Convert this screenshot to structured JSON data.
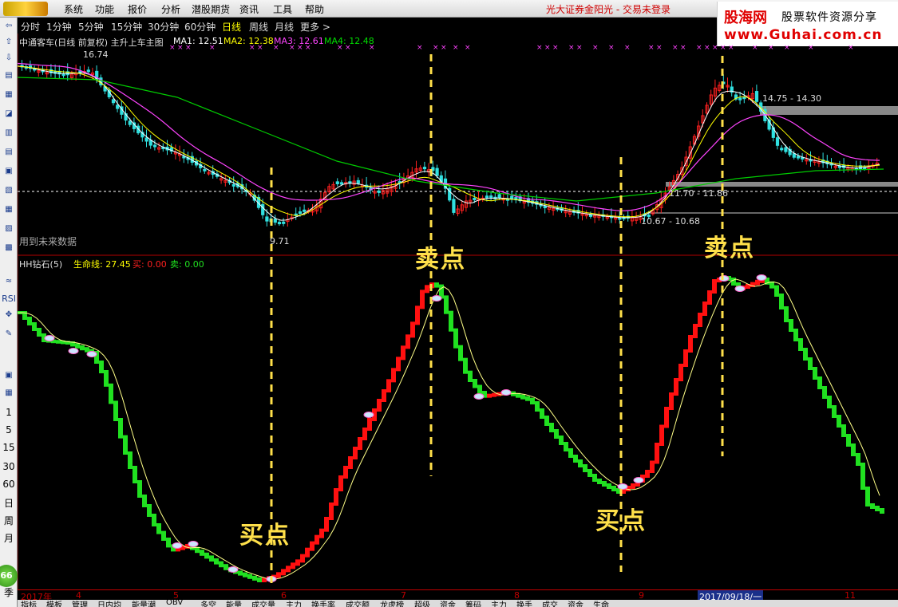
{
  "menubar": {
    "logo_text": "",
    "items": [
      "系统",
      "功能",
      "报价",
      "分析",
      "潜股期货",
      "资讯",
      "工具",
      "帮助"
    ],
    "broker_status": "光大证券金阳光 - 交易未登录"
  },
  "watermark": {
    "brand": "股海网",
    "slogan": "股票软件资源分享",
    "url": "www.Guhai.com.cn"
  },
  "periods": {
    "items": [
      "分时",
      "1分钟",
      "5分钟",
      "15分钟",
      "30分钟",
      "60分钟",
      "日线",
      "周线",
      "月线",
      "更多 >"
    ],
    "active_index": 6
  },
  "main_info": {
    "title": "中通客车(日线 前复权) 主升上车主图",
    "ma": [
      {
        "label": "MA1: 12.51",
        "color": "#ffffff"
      },
      {
        "label": "MA2: 12.38",
        "color": "#ffff00"
      },
      {
        "label": "MA3: 12.61",
        "color": "#ff44ff"
      },
      {
        "label": "MA4: 12.48",
        "color": "#00dd00"
      }
    ]
  },
  "price_notes": {
    "high1": "16.74",
    "low1": "9.71",
    "zone1": "11.70 - 11.86",
    "zone2": "10.67 - 10.68",
    "zone3": "14.75 - 14.30"
  },
  "no_future_text": "用到未来数据",
  "indicator_info": {
    "name": "HH钻石(5)",
    "lifeline": "生命线: 27.45",
    "buy": "买: 0.00",
    "sell": "卖: 0.00"
  },
  "signals": {
    "buy": "买点",
    "sell": "卖点"
  },
  "toolbar": {
    "labels": [
      "RSI",
      "1",
      "5",
      "15",
      "30",
      "60",
      "日",
      "周",
      "月",
      "66",
      "季"
    ]
  },
  "date_axis": {
    "ticks": [
      {
        "label": "2017年",
        "pos": 4
      },
      {
        "label": "4",
        "pos": 73
      },
      {
        "label": "5",
        "pos": 195
      },
      {
        "label": "6",
        "pos": 330
      },
      {
        "label": "7",
        "pos": 480
      },
      {
        "label": "8",
        "pos": 622
      },
      {
        "label": "9",
        "pos": 778
      },
      {
        "label": "11",
        "pos": 1036
      }
    ],
    "highlight": "2017/09/18/一"
  },
  "indicator_tabs": [
    "指标",
    "模板",
    "管理",
    "日内均",
    "能量潮",
    "OBV",
    "多空",
    "能量",
    "成交量",
    "主力",
    "换手率",
    "成交额",
    "龙虎榜",
    "超级",
    "资金",
    "筹码",
    "主力",
    "换手",
    "成交",
    "资金",
    "生命"
  ],
  "colors": {
    "up": "#ff2020",
    "down": "#30e0e0",
    "ind_up": "#ff1010",
    "ind_down": "#20e020",
    "signal": "#ffe04a"
  }
}
